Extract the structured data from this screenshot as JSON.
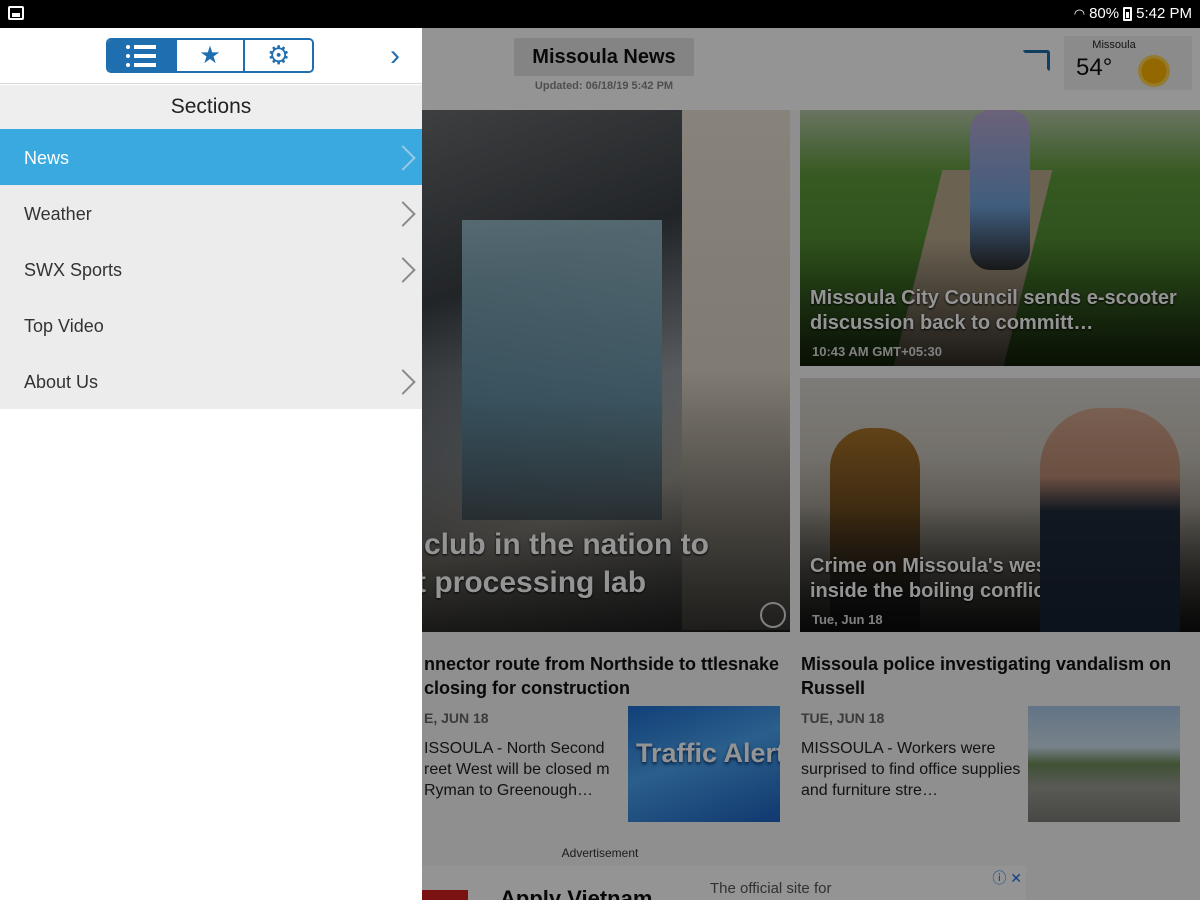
{
  "status_bar": {
    "battery": "80%",
    "time": "5:42 PM",
    "wifi_icon": "wifi-icon"
  },
  "app": {
    "title": "Missoula News",
    "updated": "Updated: 06/18/19 5:42 PM"
  },
  "weather": {
    "city": "Missoula",
    "temp": "54°",
    "icon": "sun-icon"
  },
  "drawer": {
    "tabs": [
      {
        "name": "list-icon"
      },
      {
        "name": "star-icon",
        "glyph": "★"
      },
      {
        "name": "gear-icon",
        "glyph": "⚙"
      }
    ],
    "chevron": "›",
    "header": "Sections",
    "items": [
      {
        "label": "News",
        "active": true,
        "has_chevron": true
      },
      {
        "label": "Weather",
        "active": false,
        "has_chevron": true
      },
      {
        "label": "SWX Sports",
        "active": false,
        "has_chevron": true
      },
      {
        "label": "Top Video",
        "active": false,
        "has_chevron": false
      },
      {
        "label": "About Us",
        "active": false,
        "has_chevron": true
      }
    ]
  },
  "stories": {
    "featured": {
      "title_line1": "club in the nation to",
      "title_line2": "t processing lab",
      "gallery_icon": "gallery-icon"
    },
    "scooter": {
      "title": "Missoula City Council sends e-scooter discussion back to committ…",
      "time": "10:43 AM GMT+05:30"
    },
    "crime": {
      "title": "Crime on Missoula's westside: A look inside the boiling conflict",
      "time": "Tue, Jun 18"
    },
    "connector": {
      "title": "nnector route from Northside to ttlesnake closing for construction",
      "date": "E, JUN 18",
      "snippet": "ISSOULA - North Second reet West will be closed m Ryman to Greenough…",
      "thumb_label": "Traffic Alert"
    },
    "vandalism": {
      "title": "Missoula police investigating vandalism on Russell",
      "date": "TUE, JUN 18",
      "snippet": "MISSOULA - Workers were surprised to find office supplies and furniture stre…"
    }
  },
  "ad": {
    "label": "Advertisement",
    "headline": "Apply Vietnam",
    "sub": "The official site for",
    "icons": "ⓘ ✕"
  }
}
